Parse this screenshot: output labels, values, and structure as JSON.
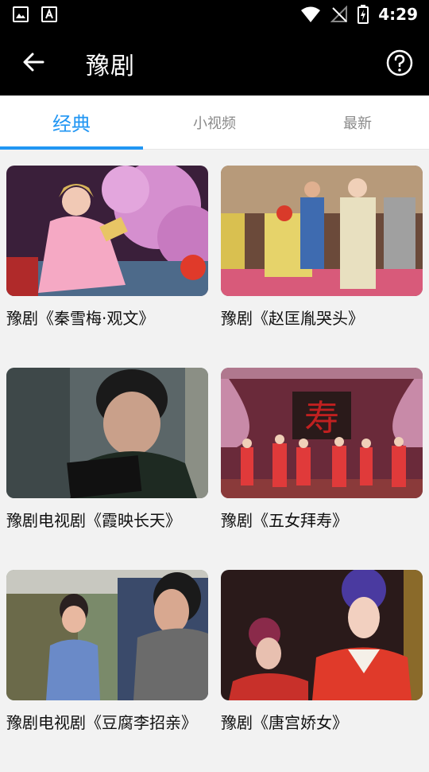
{
  "status_bar": {
    "time": "4:29"
  },
  "header": {
    "title": "豫剧"
  },
  "tabs": [
    {
      "label": "经典"
    },
    {
      "label": "小视频"
    },
    {
      "label": "最新"
    }
  ],
  "videos": [
    {
      "title": "豫剧《秦雪梅·观文》"
    },
    {
      "title": "豫剧《赵匡胤哭头》"
    },
    {
      "title": "豫剧电视剧《霞映长天》"
    },
    {
      "title": "豫剧《五女拜寿》"
    },
    {
      "title": "豫剧电视剧《豆腐李招亲》"
    },
    {
      "title": "豫剧《唐宫娇女》"
    }
  ],
  "colors": {
    "accent": "#2196f3",
    "header_bg": "#000000",
    "page_bg": "#f2f2f2"
  }
}
